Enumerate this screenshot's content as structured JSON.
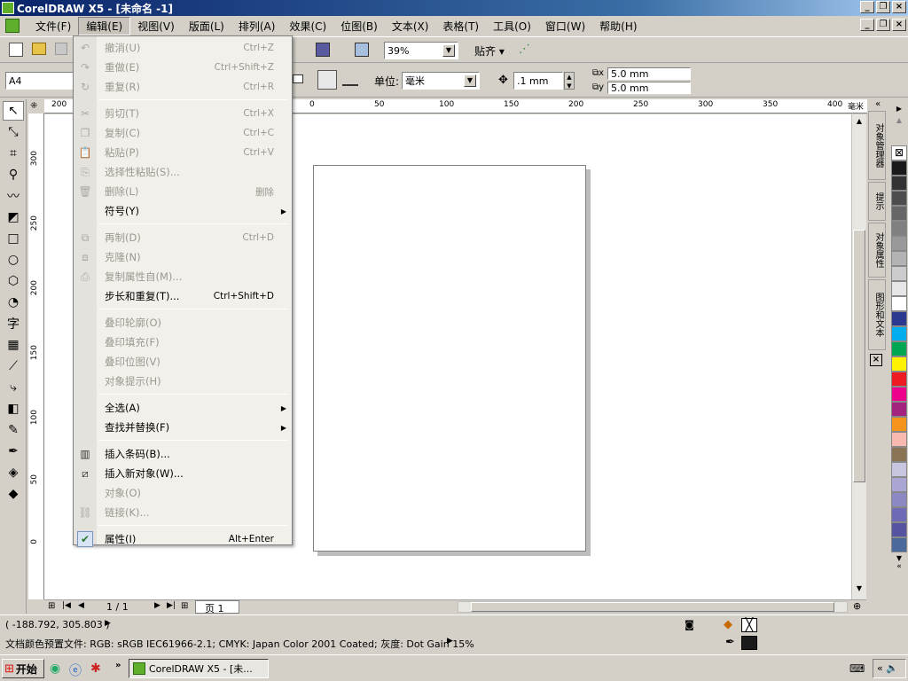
{
  "window": {
    "title": "CorelDRAW X5 - [未命名 -1]"
  },
  "menubar": [
    "文件(F)",
    "编辑(E)",
    "视图(V)",
    "版面(L)",
    "排列(A)",
    "效果(C)",
    "位图(B)",
    "文本(X)",
    "表格(T)",
    "工具(O)",
    "窗口(W)",
    "帮助(H)"
  ],
  "toolbar": {
    "zoom": "39%",
    "snap_label": "贴齐",
    "page_size": "A4",
    "units_label": "单位:",
    "units": "毫米",
    "nudge": ".1 mm",
    "dup_x": "5.0 mm",
    "dup_y": "5.0 mm"
  },
  "ruler_h": [
    "200",
    "150",
    "100",
    "50",
    "0",
    "50",
    "100",
    "150",
    "200",
    "250",
    "300",
    "350",
    "400"
  ],
  "ruler_h_unit": "毫米",
  "ruler_v": [
    "300",
    "250",
    "200",
    "150",
    "100",
    "50",
    "0"
  ],
  "edit_menu": [
    {
      "label": "撤消(U)",
      "shortcut": "Ctrl+Z",
      "disabled": true,
      "icon": "undo-icon"
    },
    {
      "label": "重做(E)",
      "shortcut": "Ctrl+Shift+Z",
      "disabled": true,
      "icon": "redo-icon"
    },
    {
      "label": "重复(R)",
      "shortcut": "Ctrl+R",
      "disabled": true,
      "icon": "repeat-icon"
    },
    {
      "sep": true
    },
    {
      "label": "剪切(T)",
      "shortcut": "Ctrl+X",
      "disabled": true,
      "icon": "cut-icon"
    },
    {
      "label": "复制(C)",
      "shortcut": "Ctrl+C",
      "disabled": true,
      "icon": "copy-icon"
    },
    {
      "label": "粘贴(P)",
      "shortcut": "Ctrl+V",
      "disabled": true,
      "icon": "paste-icon"
    },
    {
      "label": "选择性粘贴(S)...",
      "shortcut": "",
      "disabled": true,
      "icon": "paste-special-icon"
    },
    {
      "label": "删除(L)",
      "shortcut": "删除",
      "disabled": true,
      "icon": "delete-icon"
    },
    {
      "label": "符号(Y)",
      "shortcut": "",
      "disabled": false,
      "submenu": true
    },
    {
      "sep": true
    },
    {
      "label": "再制(D)",
      "shortcut": "Ctrl+D",
      "disabled": true,
      "icon": "duplicate-icon"
    },
    {
      "label": "克隆(N)",
      "shortcut": "",
      "disabled": true,
      "icon": "clone-icon"
    },
    {
      "label": "复制属性自(M)...",
      "shortcut": "",
      "disabled": true,
      "icon": "copy-properties-icon"
    },
    {
      "label": "步长和重复(T)...",
      "shortcut": "Ctrl+Shift+D",
      "disabled": false
    },
    {
      "sep": true
    },
    {
      "label": "叠印轮廓(O)",
      "shortcut": "",
      "disabled": true
    },
    {
      "label": "叠印填充(F)",
      "shortcut": "",
      "disabled": true
    },
    {
      "label": "叠印位图(V)",
      "shortcut": "",
      "disabled": true
    },
    {
      "label": "对象提示(H)",
      "shortcut": "",
      "disabled": true
    },
    {
      "sep": true
    },
    {
      "label": "全选(A)",
      "shortcut": "",
      "disabled": false,
      "submenu": true
    },
    {
      "label": "查找并替换(F)",
      "shortcut": "",
      "disabled": false,
      "submenu": true
    },
    {
      "sep": true
    },
    {
      "label": "插入条码(B)...",
      "shortcut": "",
      "disabled": false,
      "icon": "barcode-icon"
    },
    {
      "label": "插入新对象(W)...",
      "shortcut": "",
      "disabled": false,
      "icon": "insert-object-icon"
    },
    {
      "label": "对象(O)",
      "shortcut": "",
      "disabled": true
    },
    {
      "label": "链接(K)...",
      "shortcut": "",
      "disabled": true,
      "icon": "link-icon"
    },
    {
      "sep": true
    },
    {
      "label": "属性(I)",
      "shortcut": "Alt+Enter",
      "disabled": false,
      "checked": true
    }
  ],
  "dockers": [
    "对象管理器",
    "提示",
    "对象属性",
    "图形和文本"
  ],
  "palette": [
    "#ffffff",
    "#1a1a1a",
    "#333333",
    "#4d4d4d",
    "#666666",
    "#808080",
    "#999999",
    "#b3b3b3",
    "#cccccc",
    "#e6e6e6",
    "#ffffff",
    "#2b3990",
    "#00aeef",
    "#00a651",
    "#fff200",
    "#ed1c24",
    "#ec008c",
    "#a3237e",
    "#f7941d",
    "#f9b8b0",
    "#8b7355",
    "#c8c5e0",
    "#a9a6d3",
    "#8c88c4",
    "#6f6ab5",
    "#5653a1",
    "#4b6a9b"
  ],
  "page_nav": {
    "pages": "1 / 1",
    "tab": "页 1"
  },
  "status": {
    "coords": "( -188.792, 305.803 )",
    "profile": "文档颜色预置文件: RGB: sRGB IEC61966-2.1; CMYK: Japan Color 2001 Coated; 灰度: Dot Gain 15%"
  },
  "taskbar": {
    "start": "开始",
    "item": "CorelDRAW X5 - [未..."
  }
}
